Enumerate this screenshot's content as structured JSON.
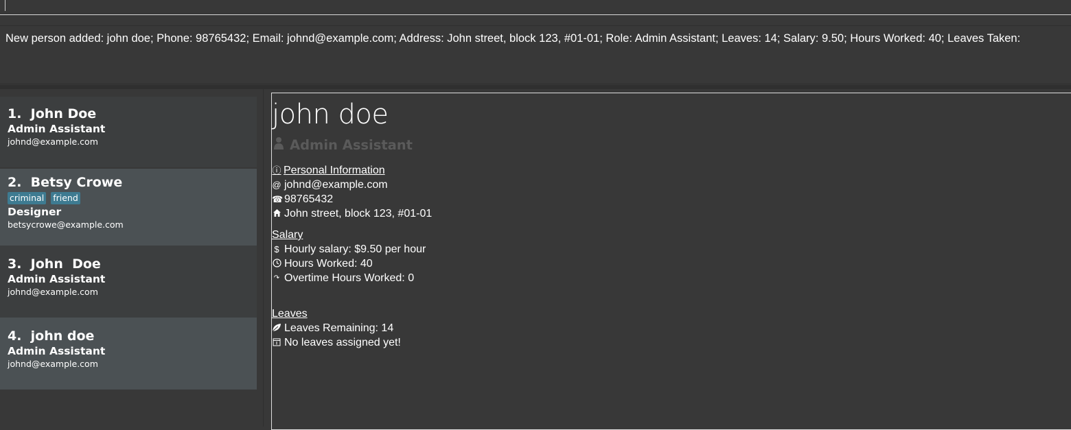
{
  "command_box": {
    "value": ""
  },
  "result": {
    "message": "New person added: john doe; Phone: 98765432; Email: johnd@example.com; Address: John street, block 123, #01-01; Role: Admin Assistant; Leaves: 14; Salary: 9.50; Hours Worked: 40; Leaves Taken:"
  },
  "person_list": [
    {
      "name": "1.  John Doe",
      "tags": [],
      "role": "Admin Assistant",
      "email": "johnd@example.com"
    },
    {
      "name": "2.  Betsy Crowe",
      "tags": [
        "criminal",
        "friend"
      ],
      "role": "Designer",
      "email": "betsycrowe@example.com"
    },
    {
      "name": "3.  John  Doe",
      "tags": [],
      "role": "Admin Assistant",
      "email": "johnd@example.com"
    },
    {
      "name": "4.  john doe",
      "tags": [],
      "role": "Admin Assistant",
      "email": "johnd@example.com"
    }
  ],
  "detail": {
    "name": "john doe",
    "role": "Admin Assistant",
    "personal_title": "Personal Information",
    "email": "johnd@example.com",
    "phone": "98765432",
    "address": "John street, block 123, #01-01",
    "salary_title": "Salary",
    "hourly_salary": "Hourly salary: $9.50 per hour",
    "hours_worked": "Hours Worked: 40",
    "overtime": "Overtime Hours Worked: 0",
    "leaves_title": "Leaves",
    "leaves_remaining": "Leaves Remaining: 14",
    "leaves_assigned": "No leaves assigned yet!"
  },
  "icons": {
    "info": "info-icon",
    "email": "at-icon",
    "phone": "phone-icon",
    "address": "home-icon",
    "salary": "dollar-icon",
    "hours": "clock-icon",
    "overtime": "overtime-icon",
    "leaves": "leaf-icon",
    "calendar": "calendar-icon",
    "role": "person-icon"
  },
  "colors": {
    "background": "#383838",
    "card_alt": "#4b5154",
    "tag": "#3e7b91",
    "role_muted": "#5a5a5a"
  }
}
